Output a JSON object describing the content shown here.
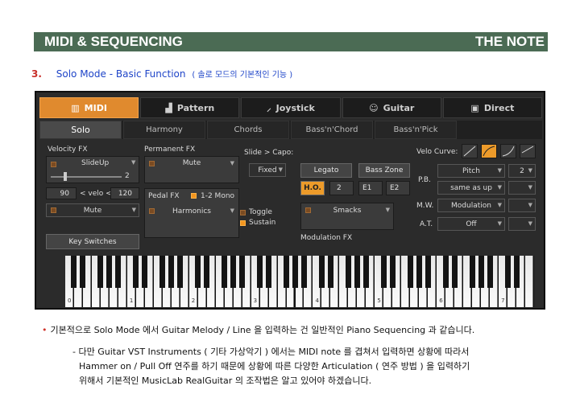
{
  "header": {
    "left": "MIDI & SEQUENCING",
    "right": "THE NOTE"
  },
  "section": {
    "number": "3.",
    "title": "Solo Mode - Basic Function",
    "subtitle": "( 솔로 모드의 기본적인 기능 )"
  },
  "plugin": {
    "top_tabs": [
      {
        "label": "MIDI",
        "icon": "keyboard-icon",
        "active": true
      },
      {
        "label": "Pattern",
        "icon": "pattern-icon",
        "active": false
      },
      {
        "label": "Joystick",
        "icon": "guitar-icon",
        "active": false
      },
      {
        "label": "Guitar",
        "icon": "pick-icon",
        "active": false
      },
      {
        "label": "Direct",
        "icon": "direct-icon",
        "active": false
      }
    ],
    "sub_tabs": [
      {
        "label": "Solo",
        "active": true
      },
      {
        "label": "Harmony",
        "active": false
      },
      {
        "label": "Chords",
        "active": false
      },
      {
        "label": "Bass'n'Chord",
        "active": false
      },
      {
        "label": "Bass'n'Pick",
        "active": false
      }
    ],
    "velocity_fx": {
      "label": "Velocity FX",
      "value": "SlideUp",
      "amount": "2",
      "low": "90",
      "mid_label": "< velo <",
      "high": "120",
      "mode": "Mute",
      "key_switches": "Key Switches"
    },
    "permanent_fx": {
      "label": "Permanent FX",
      "value": "Mute"
    },
    "pedal_fx": {
      "label": "Pedal FX",
      "mono_label": "1-2 Mono",
      "value": "Harmonics",
      "toggle": "Toggle",
      "sustain": "Sustain"
    },
    "slide_capo": {
      "label": "Slide > Capo:",
      "value": "Fixed"
    },
    "legato": "Legato",
    "bass_zone": "Bass Zone",
    "ho": {
      "label": "H.O.",
      "value": "2",
      "e1": "E1",
      "e2": "E2"
    },
    "modulation_fx": {
      "label": "Modulation FX",
      "value": "Smacks"
    },
    "velo_curve": {
      "label": "Velo Curve:"
    },
    "pb": {
      "label": "P.B.",
      "value": "Pitch",
      "amount": "2",
      "mode": "same as up"
    },
    "mw": {
      "label": "M.W.",
      "value": "Modulation"
    },
    "at": {
      "label": "A.T.",
      "value": "Off"
    },
    "octaves": [
      "0",
      "1",
      "2",
      "3",
      "4",
      "5",
      "6",
      "7"
    ]
  },
  "body": {
    "bullet": "기본적으로 Solo Mode 에서 Guitar Melody / Line 을 입력하는 건 일반적인 Piano Sequencing 과 같습니다.",
    "dash1": "- 다만 Guitar VST Instruments ( 기타 가상악기 ) 에서는 MIDI note 를 겹쳐서 입력하면 상황에 따라서",
    "dash2": "Hammer on / Pull Off 연주를 하기 때문에 상황에 따른 다양한 Articulation ( 연주 방법 ) 을 입력하기",
    "dash3": "위해서 기본적인 MusicLab RealGuitar 의 조작법은 알고 있어야 하겠습니다."
  }
}
